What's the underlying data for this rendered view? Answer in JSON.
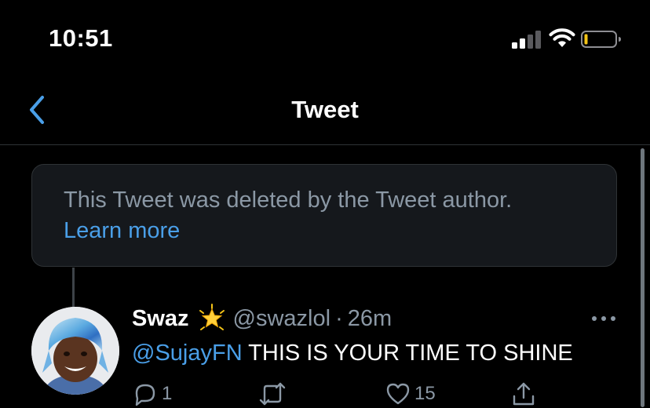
{
  "status_bar": {
    "time": "10:51"
  },
  "nav": {
    "title": "Tweet",
    "back_icon": "chevron-left-icon"
  },
  "deleted_notice": {
    "message": "This Tweet was deleted by the Tweet author.",
    "link": "Learn more"
  },
  "reply": {
    "display_name": "Swaz",
    "name_emoji": "glowing-star-icon",
    "handle": "@swazlol",
    "separator": "·",
    "time": "26m",
    "mention": "@SujayFN",
    "text": " THIS IS YOUR TIME TO SHINE",
    "actions": {
      "reply_count": "1",
      "retweet_count": "",
      "like_count": "15"
    }
  },
  "colors": {
    "background": "#000000",
    "accent": "#4a9fe8",
    "secondary_text": "#8b98a5",
    "notice_background": "#15181c",
    "border": "#2f3336",
    "battery_low": "#f5c518"
  }
}
